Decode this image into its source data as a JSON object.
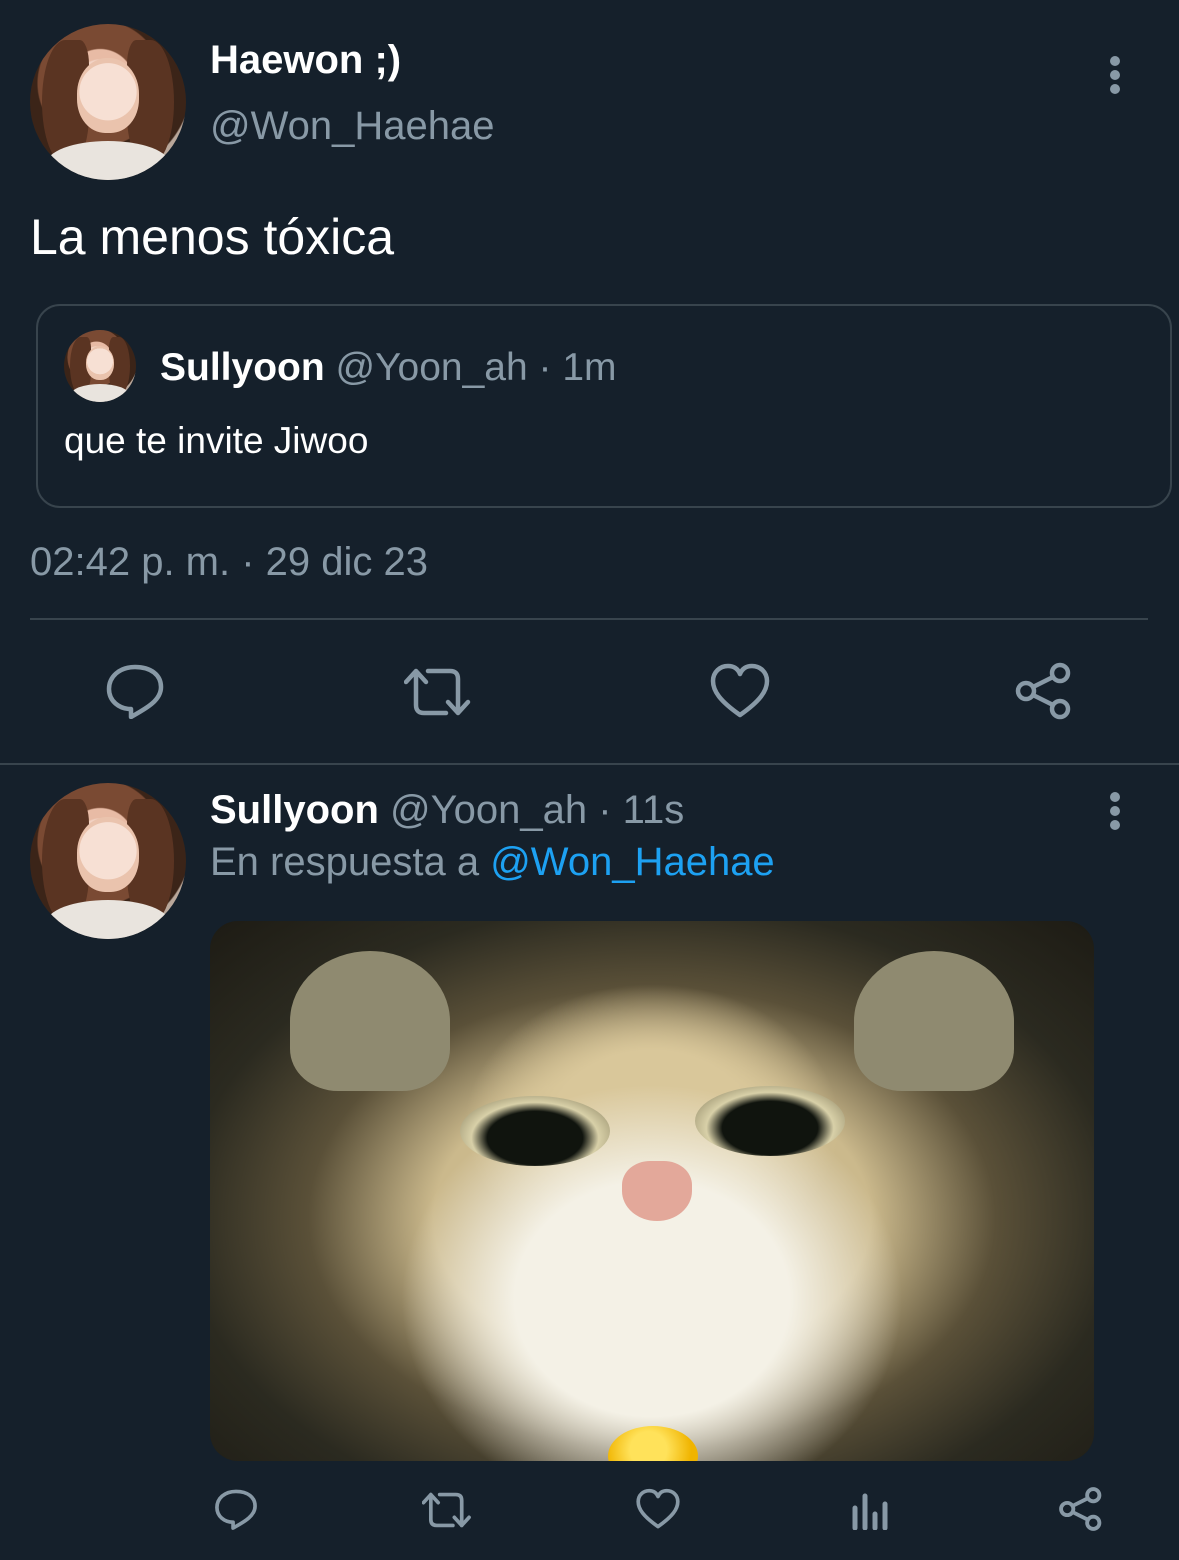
{
  "main_tweet": {
    "display_name": "Haewon ;)",
    "handle": "@Won_Haehae",
    "text": "La menos tóxica",
    "timestamp": "02:42 p. m. · 29 dic 23",
    "more_icon": "more-vertical-icon"
  },
  "quoted_tweet": {
    "display_name": "Sullyoon",
    "handle": "@Yoon_ah",
    "time": "· 1m",
    "text": "que te invite Jiwoo"
  },
  "actions": {
    "icons": [
      "reply-icon",
      "retweet-icon",
      "like-icon",
      "share-icon"
    ]
  },
  "reply_tweet": {
    "display_name": "Sullyoon",
    "handle": "@Yoon_ah",
    "time": "· 11s",
    "reply_prefix": "En respuesta a",
    "reply_to": "@Won_Haehae",
    "media_alt": "grumpy kitten photo",
    "action_icons": [
      "reply-icon",
      "retweet-icon",
      "like-icon",
      "analytics-icon",
      "share-icon"
    ]
  },
  "colors": {
    "background": "#15202b",
    "muted": "#8899a6",
    "link": "#1da1f2",
    "border": "#38444d"
  }
}
